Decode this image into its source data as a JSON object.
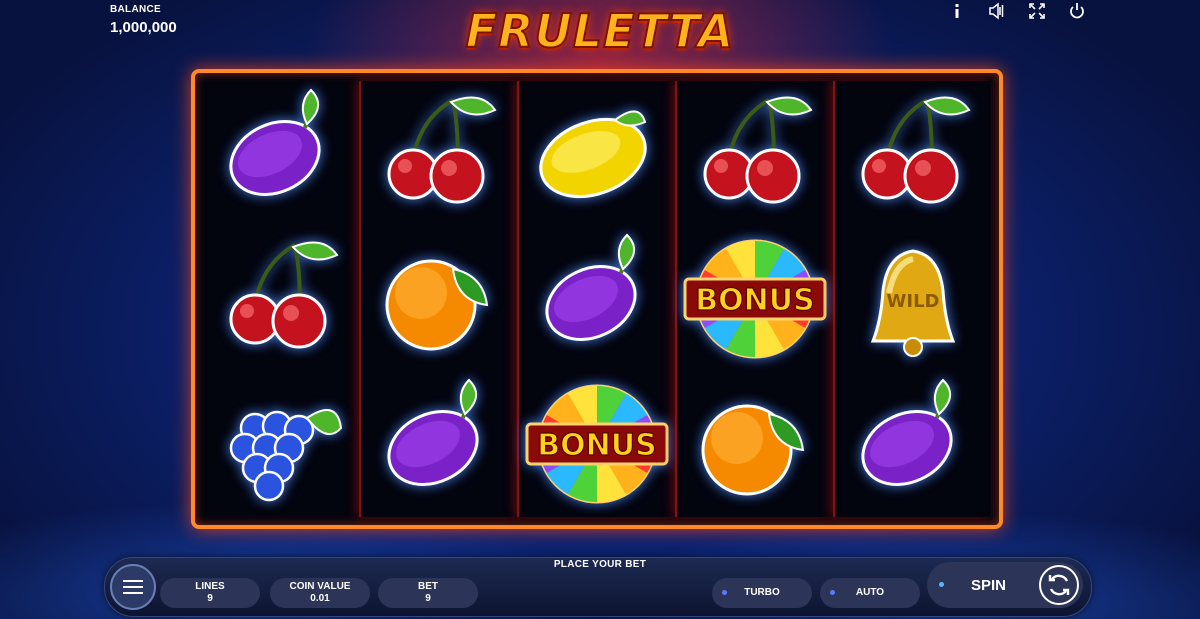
{
  "header": {
    "balance_label": "BALANCE",
    "balance_value": "1,000,000",
    "logo": "FRULETTA"
  },
  "top_icons": [
    "info-icon",
    "sound-icon",
    "fullscreen-icon",
    "power-icon"
  ],
  "reels": [
    [
      "plum",
      "cherry",
      "grapes"
    ],
    [
      "cherry",
      "orange",
      "plum"
    ],
    [
      "lemon",
      "plum",
      "bonus"
    ],
    [
      "cherry",
      "bonus",
      "orange"
    ],
    [
      "cherry",
      "wild-bell",
      "plum"
    ]
  ],
  "symbol_text": {
    "bonus": "BONUS",
    "wild": "WILD"
  },
  "bottom_bar": {
    "status": "PLACE YOUR BET",
    "lines_label": "LINES",
    "lines_value": "9",
    "coin_label": "COIN VALUE",
    "coin_value": "0.01",
    "bet_label": "BET",
    "bet_value": "9",
    "turbo_label": "TURBO",
    "auto_label": "AUTO",
    "spin_label": "SPIN"
  },
  "colors": {
    "frame": "#ff8a2a",
    "reel_divider": "#e61e1e",
    "logo": "#ffb21c"
  }
}
